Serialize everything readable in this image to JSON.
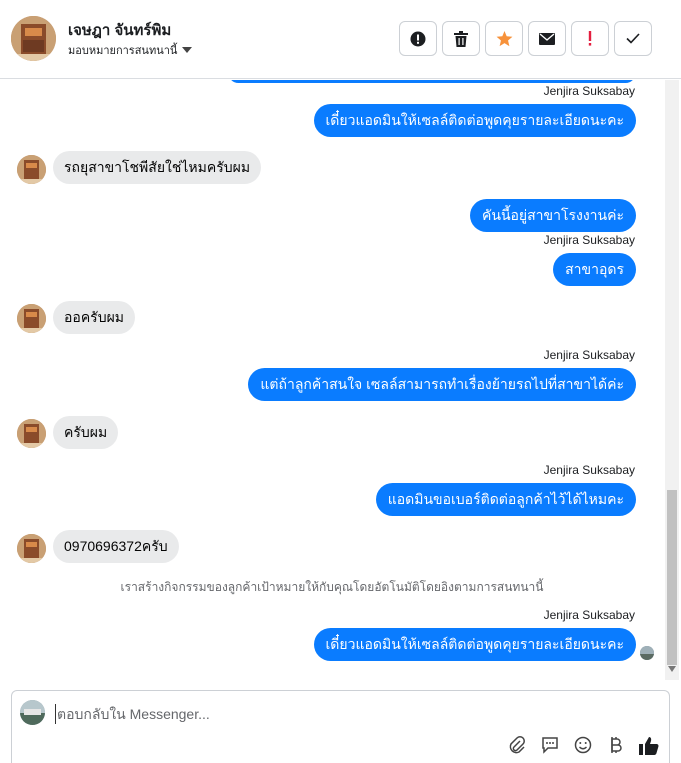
{
  "header": {
    "contact_name": "เจษฎา จันทร์พิม",
    "assign_label": "มอบหมายการสนทนานี้"
  },
  "composer": {
    "placeholder": "ตอบกลับใน Messenger..."
  },
  "messages": {
    "m1": {
      "text": "เดี๋ยวแอดมินให้เซลล์ติดต่อพูดคุยรายละเอียดนะคะ"
    },
    "m1_sender": "Jenjira Suksabay",
    "m2": {
      "text": "รถยุสาขาโชพีสัยใช่ไหมครับผม"
    },
    "m3": {
      "text": "คันนี้อยู่สาขาโรงงานค่ะ"
    },
    "m3_sender": "Jenjira Suksabay",
    "m4": {
      "text": "สาขาอุดร"
    },
    "m5": {
      "text": "ออครับผม"
    },
    "m6_sender": "Jenjira Suksabay",
    "m6": {
      "text": "แต่ถ้าลูกค้าสนใจ เซลล์สามารถทำเรื่องย้ายรถไปที่สาขาได้ค่ะ"
    },
    "m7": {
      "text": "ครับผม"
    },
    "m8_sender": "Jenjira Suksabay",
    "m8": {
      "text": "แอดมินขอเบอร์ติดต่อลูกค้าไว้ได้ไหมคะ"
    },
    "m9": {
      "text": "0970696372ครับ"
    },
    "system_note": "เราสร้างกิจกรรมของลูกค้าเป้าหมายให้กับคุณโดยอัตโนมัติโดยอิงตามการสนทนานี้",
    "m10_sender": "Jenjira Suksabay",
    "m10": {
      "text": "เดี๋ยวแอดมินให้เซลล์ติดต่อพูดคุยรายละเอียดนะคะ"
    }
  },
  "icons": {
    "actions": [
      "info-icon",
      "trash-icon",
      "star-icon",
      "envelope-icon",
      "exclamation-icon",
      "check-icon"
    ],
    "composer": [
      "attach-icon",
      "saved-replies-icon",
      "emoji-icon",
      "baht-icon",
      "thumbs-up-icon"
    ]
  },
  "colors": {
    "outgoing_bubble": "#0a7cff",
    "incoming_bubble": "#e9eaeb",
    "star": "#f7923b",
    "exclamation": "#e41e3f"
  }
}
